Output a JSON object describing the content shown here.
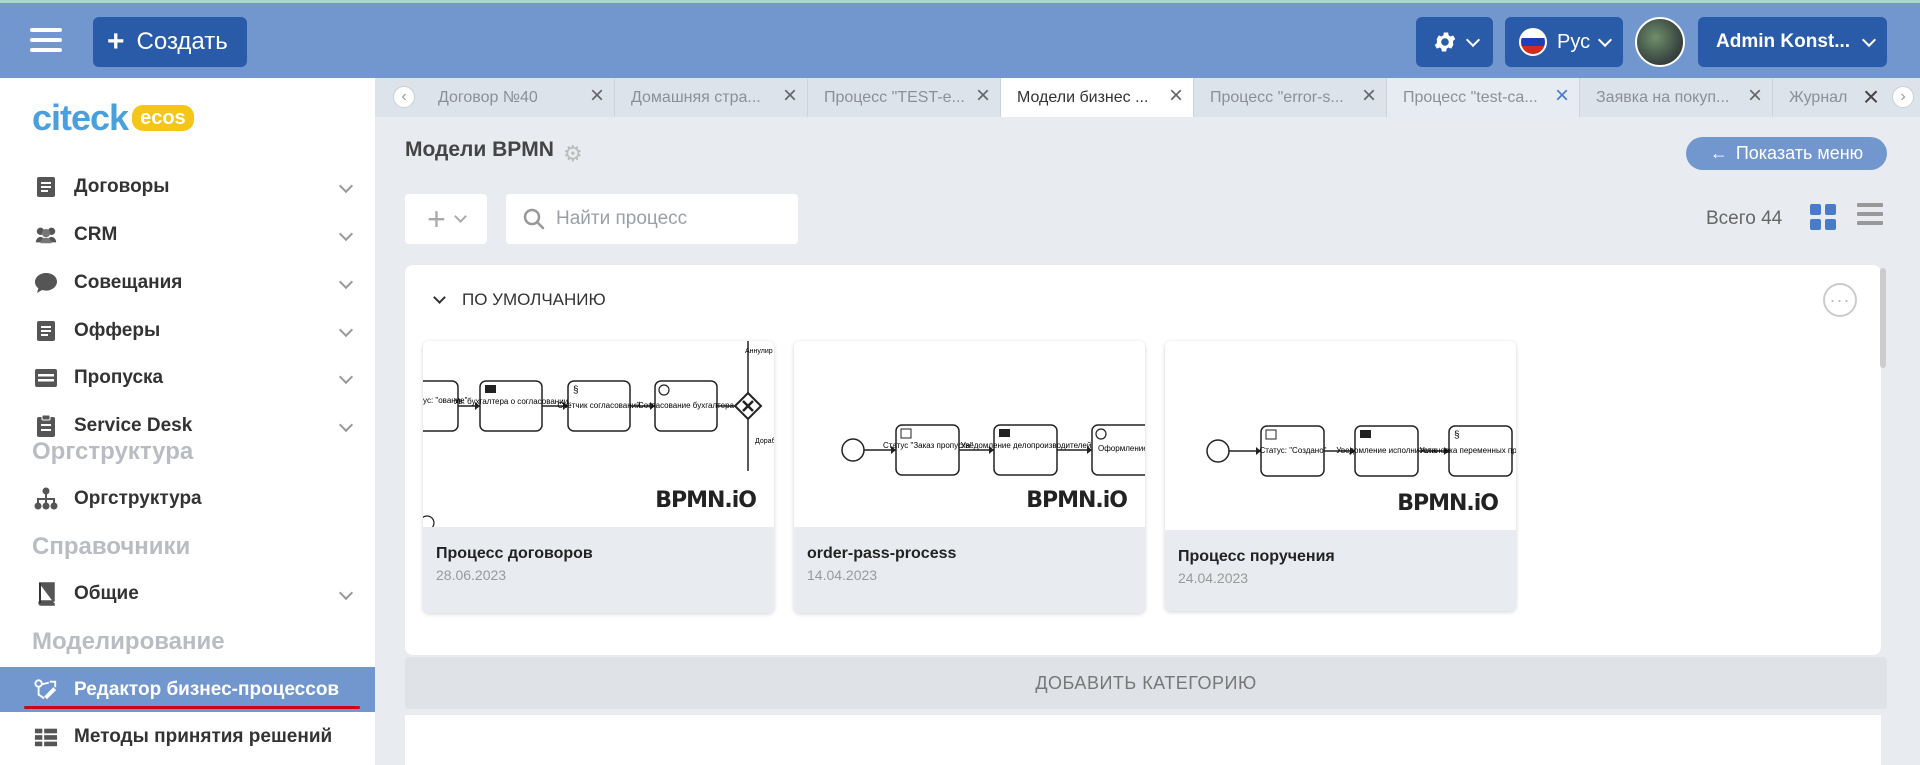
{
  "header": {
    "create_label": "Создать",
    "language_label": "Рус",
    "user_label": "Admin Konst...",
    "accent_color": "#7297cf",
    "button_color": "#2a5ba8"
  },
  "sidebar": {
    "logo_text": "citeck",
    "logo_badge": "ecos",
    "items": [
      {
        "label": "Договоры",
        "icon": "document-icon"
      },
      {
        "label": "CRM",
        "icon": "people-icon"
      },
      {
        "label": "Совещания",
        "icon": "chat-icon"
      },
      {
        "label": "Офферы",
        "icon": "document-icon"
      },
      {
        "label": "Пропуска",
        "icon": "card-icon"
      },
      {
        "label": "Service Desk",
        "icon": "clipboard-icon"
      }
    ],
    "section_orgstructure": "Оргструктура",
    "item_orgstructure": "Оргструктура",
    "section_directories": "Справочники",
    "item_general": "Общие",
    "section_modeling": "Моделирование",
    "item_bp_editor": "Редактор бизнес-процессов",
    "item_decision_methods": "Методы принятия решений"
  },
  "tabs": [
    {
      "label": "Договор №40"
    },
    {
      "label": "Домашняя стра..."
    },
    {
      "label": "Процесс \"TEST-e..."
    },
    {
      "label": "Модели бизнес ..."
    },
    {
      "label": "Процесс \"error-s..."
    },
    {
      "label": "Процесс \"test-ca..."
    },
    {
      "label": "Заявка на покуп..."
    },
    {
      "label": "Журнал"
    }
  ],
  "page": {
    "title": "Модели BPMN",
    "show_menu_label": "Показать меню",
    "search_placeholder": "Найти процесс",
    "total_label": "Всего 44"
  },
  "category": {
    "name": "ПО УМОЛЧАНИЮ",
    "add_category_label": "ДОБАВИТЬ КАТЕГОРИЮ"
  },
  "cards": [
    {
      "name": "Процесс договоров",
      "date": "28.06.2023",
      "watermark": "BPMN.iO",
      "nodes": [
        "атус: \"ование\"",
        "Ув. бухгалтера о согласовании",
        "Счётчик согласований",
        "Согласование бухгалтера"
      ],
      "edge_labels": [
        "Аннулир",
        "Дораб"
      ]
    },
    {
      "name": "order-pass-process",
      "date": "14.04.2023",
      "watermark": "BPMN.iO",
      "nodes": [
        "Статус \"Заказ пропуска\"",
        "Уведомление делопроизводителей",
        "Оформление пропуска"
      ]
    },
    {
      "name": "Процесс поручения",
      "date": "24.04.2023",
      "watermark": "BPMN.iO",
      "nodes": [
        "Статус: \"Создано\"",
        "Уведомление исполнителю",
        "Установка переменных процесса"
      ]
    }
  ]
}
